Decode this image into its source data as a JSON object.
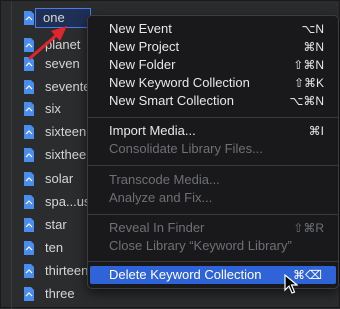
{
  "sidebar": {
    "items": [
      {
        "label": "one"
      },
      {
        "label": "planet"
      },
      {
        "label": "seven"
      },
      {
        "label": "seventeen"
      },
      {
        "label": "six"
      },
      {
        "label": "sixteen"
      },
      {
        "label": "sixtheen"
      },
      {
        "label": "solar"
      },
      {
        "label": "spa...uses"
      },
      {
        "label": "star"
      },
      {
        "label": "ten"
      },
      {
        "label": "thirteen"
      },
      {
        "label": "three"
      }
    ]
  },
  "menu": {
    "new_event": {
      "label": "New Event",
      "shortcut": "⌥N"
    },
    "new_project": {
      "label": "New Project",
      "shortcut": "⌘N"
    },
    "new_folder": {
      "label": "New Folder",
      "shortcut": "⇧⌘N"
    },
    "new_keyword_collection": {
      "label": "New Keyword Collection",
      "shortcut": "⇧⌘K"
    },
    "new_smart_collection": {
      "label": "New Smart Collection",
      "shortcut": "⌥⌘N"
    },
    "import_media": {
      "label": "Import Media...",
      "shortcut": "⌘I"
    },
    "consolidate_library_files": {
      "label": "Consolidate Library Files...",
      "shortcut": ""
    },
    "transcode_media": {
      "label": "Transcode Media...",
      "shortcut": ""
    },
    "analyze_and_fix": {
      "label": "Analyze and Fix...",
      "shortcut": ""
    },
    "reveal_in_finder": {
      "label": "Reveal In Finder",
      "shortcut": "⇧⌘R"
    },
    "close_library": {
      "label": "Close Library “Keyword Library”",
      "shortcut": ""
    },
    "delete_keyword_collection": {
      "label": "Delete Keyword Collection",
      "shortcut": "⌘⌫"
    }
  },
  "colors": {
    "highlight": "#2f64d8",
    "annotation_arrow": "#e0262d"
  }
}
